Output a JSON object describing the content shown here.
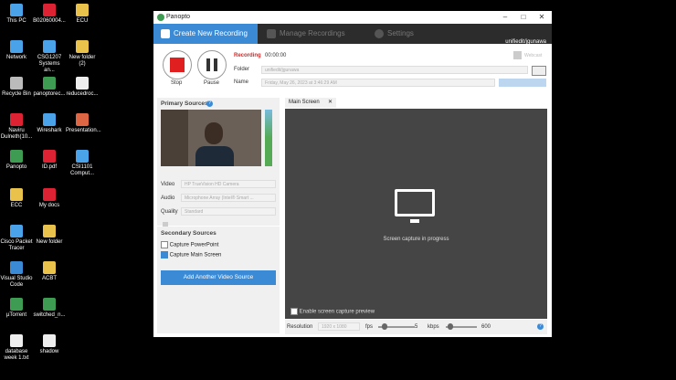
{
  "desktop": {
    "icons": [
      {
        "label": "This PC",
        "color": "#4aa3e8"
      },
      {
        "label": "B02060004...",
        "color": "#d23"
      },
      {
        "label": "ECU",
        "color": "#e8c24a"
      },
      {
        "label": "Network",
        "color": "#4aa3e8"
      },
      {
        "label": "CSG1207 Systems an...",
        "color": "#4aa3e8"
      },
      {
        "label": "New folder (2)",
        "color": "#e8c24a"
      },
      {
        "label": "Recycle Bin",
        "color": "#bbb"
      },
      {
        "label": "panoptorec...",
        "color": "#3d9b52"
      },
      {
        "label": "reducedroc...",
        "color": "#eee"
      },
      {
        "label": "Naviru Dulneth(10...",
        "color": "#d23"
      },
      {
        "label": "Wireshark",
        "color": "#4aa3e8"
      },
      {
        "label": "Presentation...",
        "color": "#d64"
      },
      {
        "label": "Panopto",
        "color": "#3d9b52"
      },
      {
        "label": "ID.pdf",
        "color": "#d23"
      },
      {
        "label": "CSI1101 Comput...",
        "color": "#4aa3e8"
      },
      {
        "label": "ECC",
        "color": "#e8c24a"
      },
      {
        "label": "My docs",
        "color": "#d23"
      },
      {
        "label": "Cisco Packet Tracer",
        "color": "#4aa3e8"
      },
      {
        "label": "New folder",
        "color": "#e8c24a"
      },
      {
        "label": "Visual Studio Code",
        "color": "#3a8ad6"
      },
      {
        "label": "ACBT",
        "color": "#e8c24a"
      },
      {
        "label": "µTorrent",
        "color": "#3d9b52"
      },
      {
        "label": "switched_n...",
        "color": "#3d9b52"
      },
      {
        "label": "database week 1.txt",
        "color": "#eee"
      },
      {
        "label": "shadow",
        "color": "#eee"
      }
    ]
  },
  "window": {
    "title": "Panopto",
    "controls": {
      "minimize": "–",
      "maximize": "□",
      "close": "✕"
    },
    "tabs": [
      "Create New Recording",
      "Manage Recordings",
      "Settings"
    ],
    "user": {
      "name": "unifiedit/jgunawa",
      "signout": "Sign out"
    }
  },
  "recording": {
    "status": "Recording",
    "time": "00:00:00",
    "stop_label": "Stop",
    "pause_label": "Pause",
    "folder_label": "Folder",
    "folder_value": "unifiedit/jgunawa",
    "name_label": "Name",
    "name_value": "Friday, May 26, 2023 at 3:46:29 AM",
    "webcast_label": "Webcast"
  },
  "primary": {
    "title": "Primary Sources",
    "video_label": "Video",
    "video_value": "HP TrueVision HD Camera",
    "audio_label": "Audio",
    "audio_value": "Microphone Array (Intel® Smart ...",
    "quality_label": "Quality",
    "quality_value": "Standard"
  },
  "secondary": {
    "title": "Secondary Sources",
    "capture_ppt": "Capture PowerPoint",
    "capture_main": "Capture Main Screen",
    "add_button": "Add Another Video Source"
  },
  "preview": {
    "tab_label": "Main Screen",
    "message": "Screen capture in progress",
    "enable_preview": "Enable screen capture preview",
    "resolution_label": "Resolution",
    "resolution_value": "1920 x 1080",
    "fps_label": "fps",
    "fps_value": "5",
    "kbps_label": "kbps",
    "kbps_value": "600"
  }
}
